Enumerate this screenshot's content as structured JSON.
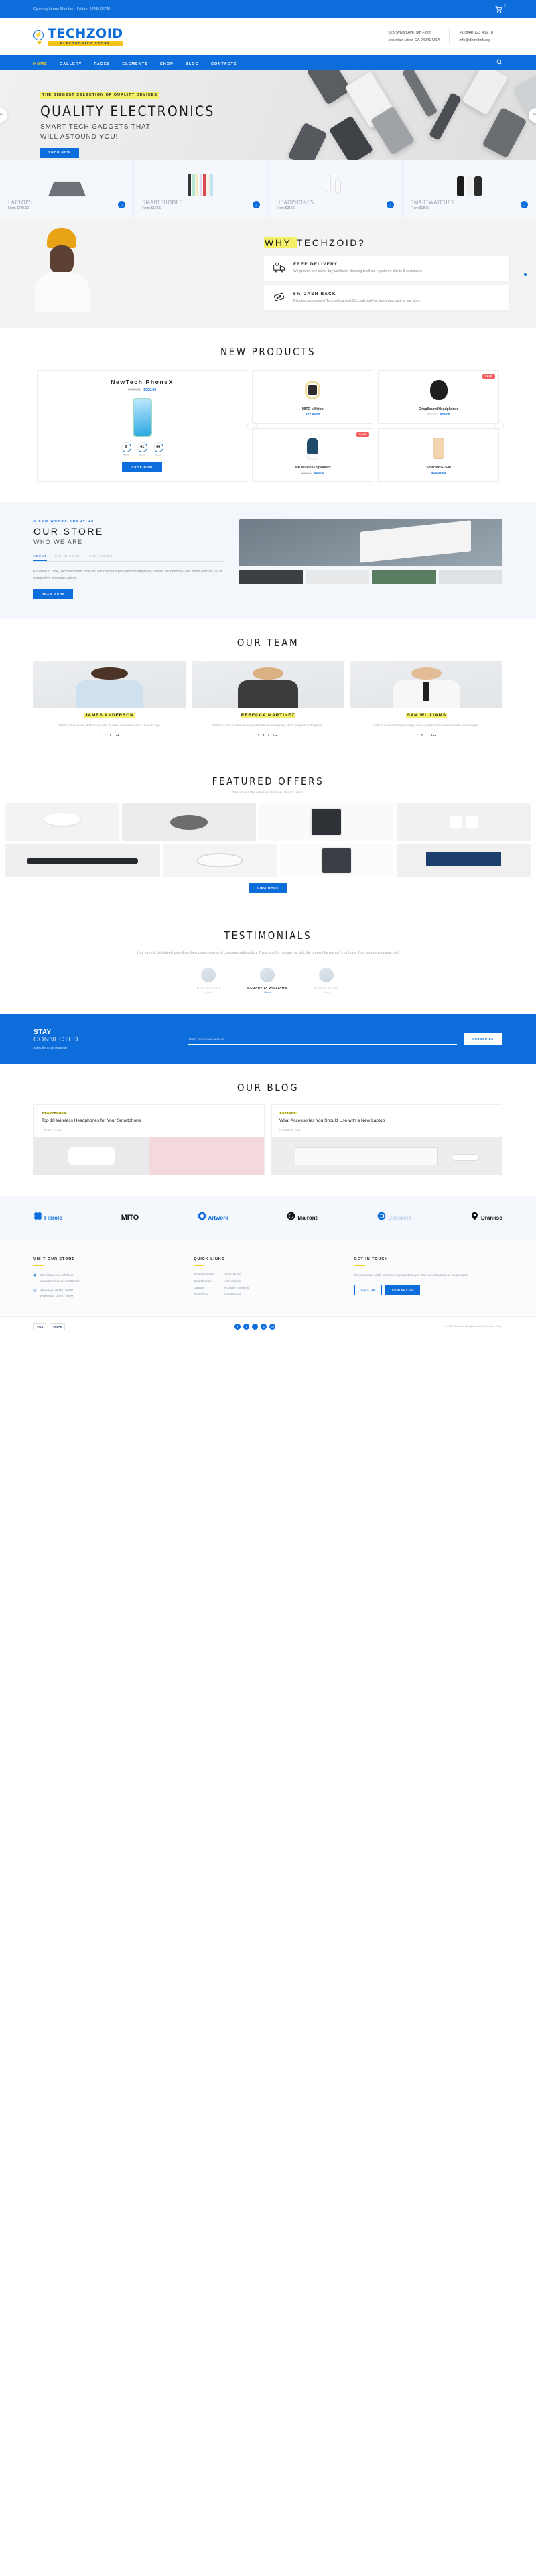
{
  "topbar": {
    "hours": "Opening hours: Monday - Friday: 08AM-06PM",
    "cart_count": "2"
  },
  "header": {
    "logo_name": "TECHZOID",
    "logo_sub": "ELECTRONICS STORE",
    "address_line1": "523 Sylvan Ave, 5th Floor",
    "address_line2": "Mountain View, CA 94041 USA",
    "phone": "+1 (844) 123 456 78",
    "email": "info@demolink.org"
  },
  "nav": {
    "items": [
      "HOME",
      "GALLERY",
      "PAGES",
      "ELEMENTS",
      "SHOP",
      "BLOG",
      "CONTACTS"
    ],
    "active": "HOME"
  },
  "hero": {
    "tag": "THE BIGGEST SELECTION OF QUALITY DEVICES",
    "title": "QUALITY ELECTRONICS",
    "subtitle_line1": "SMART TECH GADGETS THAT",
    "subtitle_line2": "WILL ASTOUND YOU!",
    "button": "SHOP NOW",
    "prev": "prev",
    "next": "next"
  },
  "categories": [
    {
      "name": "LAPTOPS",
      "price": "From $289.00"
    },
    {
      "name": "SMARTPHONES",
      "price": "From $12.00"
    },
    {
      "name": "HEADPHONES",
      "price": "From $21.00"
    },
    {
      "name": "SMARTWATCHES",
      "price": "From $18.00"
    }
  ],
  "why": {
    "title_pre": "WHY ",
    "title_main": "TECHZOID?",
    "features": [
      {
        "icon": "delivery-truck-icon",
        "title": "FREE DELIVERY",
        "text": "We provide free same-day worldwide shipping to all our registered clients & customers."
      },
      {
        "icon": "discount-tag-icon",
        "title": "5% CASH BACK",
        "text": "Regular customers of Techzoid can get 5% cash back for every purchase at our store."
      }
    ]
  },
  "new_products": {
    "title": "NEW PRODUCTS",
    "featured": {
      "name": "NewTech PhoneX",
      "old_price": "$490.00",
      "new_price": "$530.00",
      "timer": [
        {
          "value": "9",
          "label": "HRS"
        },
        {
          "value": "41",
          "label": "MIN"
        },
        {
          "value": "46",
          "label": "SEC"
        }
      ],
      "button": "SHOP NOW"
    },
    "items": [
      {
        "name": "MITO uWatch",
        "old_price": "",
        "price": "$17.99.00",
        "sale": false
      },
      {
        "name": "CrispSound Headphones",
        "old_price": "$32.00",
        "price": "$22.00",
        "sale": true,
        "sale_label": "SALE"
      },
      {
        "name": "AIR Wireless Speakers",
        "old_price": "$30.00",
        "price": "$23.00",
        "sale": true,
        "sale_label": "SALE"
      },
      {
        "name": "Smartex GT540",
        "old_price": "",
        "price": "$16.99.00",
        "sale": false
      }
    ]
  },
  "store": {
    "eyebrow": "A FEW WORDS ABOUT US",
    "title": "OUR STORE",
    "subtitle": "WHO WE ARE",
    "tabs": [
      "ABOUT",
      "OUR MISSION",
      "OUR VISION"
    ],
    "active_tab": "ABOUT",
    "text": "Founded in 1994, Techzoid offers new and refurbished laptop and smartphones, tablets, headphones, and smart watches, all at competitive wholesale prices.",
    "button": "READ MORE"
  },
  "team": {
    "title": "OUR TEAM",
    "members": [
      {
        "name": "JAMES ANDERSON",
        "bio": "James is the owner of Techzoid who founded our online store 10 years ago."
      },
      {
        "name": "REBECCA MARTINEZ",
        "bio": "Rebecca is our sales manager who knows everything about gadgets and laptops."
      },
      {
        "name": "SAM WILLIAMS",
        "bio": "Sam is our marketing manager who is passionate about modern technologies."
      }
    ],
    "socials": [
      "f",
      "t",
      "i",
      "G+"
    ]
  },
  "offers": {
    "title": "FEATURED OFFERS",
    "subtitle": "Take a look at the newest products we offer our clients.",
    "button": "VIEW MORE"
  },
  "testimonials": {
    "title": "TESTIMONIALS",
    "quote": "Your store is definitively one of our best ones in terms of customer satisfaction. Thank you for helping me pick the present for my son's birthday. Your service is unmatched!",
    "people": [
      {
        "name": "BILL WILSON",
        "role": "Client",
        "active": false
      },
      {
        "name": "SAMANTHA WILLIAMS",
        "role": "Client",
        "active": true
      },
      {
        "name": "JAMES SMITH",
        "role": "Client",
        "active": false
      }
    ]
  },
  "newsletter": {
    "title1": "STAY",
    "title2": "CONNECTED",
    "subtitle": "Subscribe to our newsletter",
    "placeholder": "Enter your e-mail address",
    "button": "SUBSCRIBE"
  },
  "blog": {
    "title": "OUR BLOG",
    "posts": [
      {
        "category": "HEADPHONES",
        "title": "Top 10 Wireless Headphones for Your Smartphone",
        "date": "February 9, 2021"
      },
      {
        "category": "LAPTOPS",
        "title": "What Accessories You Should Use with a New Laptop",
        "date": "February 9, 2021"
      }
    ]
  },
  "brands": [
    {
      "name": "Fibrolo",
      "icon": "clover-icon"
    },
    {
      "name": "MITO",
      "icon": "text-logo"
    },
    {
      "name": "Artworx",
      "icon": "diamond-icon"
    },
    {
      "name": "Maironti",
      "icon": "spiral-icon"
    },
    {
      "name": "Decoroto",
      "icon": "swirl-icon"
    },
    {
      "name": "Drankso",
      "icon": "pin-icon"
    }
  ],
  "footer": {
    "col1": {
      "heading": "VISIT OUR STORE",
      "address_line1": "523 Sylvan Ave, 5th Floor",
      "address_line2": "Mountain View, CA 94041 USA",
      "hours_line1": "Weekdays:    08AM - 06PM",
      "hours_line2": "Weekends:    10AM - 06PM"
    },
    "col2": {
      "heading": "QUICK LINKS",
      "links_a": [
        "Smart Watches",
        "Smartphones",
        "Laptops",
        "Smart Toys"
      ],
      "links_b": [
        "Smart Home",
        "Accessories",
        "Portable Speakers",
        "Headphones"
      ]
    },
    "col3": {
      "heading": "GET IN TOUCH",
      "text": "We are always ready to answer any questions you may have about one of our products.",
      "btn1": "CALL US",
      "btn2": "CONTACT US"
    }
  },
  "copyright": {
    "payments": [
      "VISA",
      "PayPal"
    ],
    "text": "© 2021 Techzoid. All rights reserved. Privacy Policy",
    "socials": [
      "f",
      "t",
      "i",
      "in",
      "G+"
    ]
  }
}
